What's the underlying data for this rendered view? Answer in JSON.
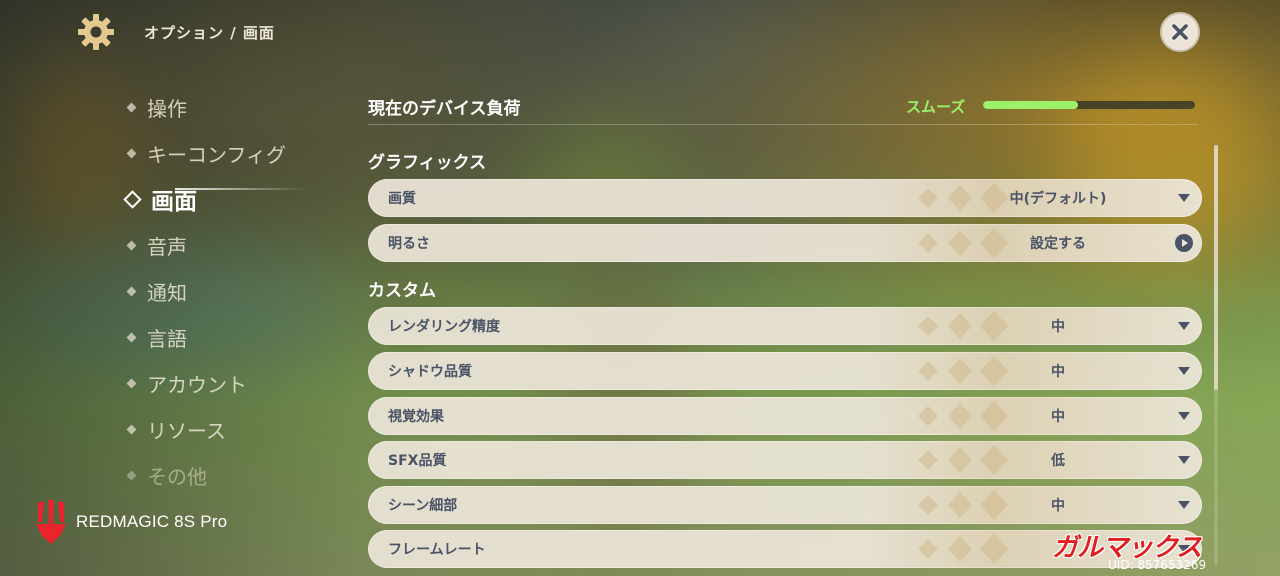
{
  "header": {
    "breadcrumb": "オプション / 画面",
    "gear_icon": "gear-icon",
    "close_icon": "close-icon"
  },
  "sidebar": {
    "items": [
      {
        "label": "操作",
        "state": "normal"
      },
      {
        "label": "キーコンフィグ",
        "state": "normal"
      },
      {
        "label": "画面",
        "state": "active"
      },
      {
        "label": "音声",
        "state": "normal"
      },
      {
        "label": "通知",
        "state": "normal"
      },
      {
        "label": "言語",
        "state": "normal"
      },
      {
        "label": "アカウント",
        "state": "normal"
      },
      {
        "label": "リソース",
        "state": "normal"
      },
      {
        "label": "その他",
        "state": "faded"
      }
    ]
  },
  "device_load": {
    "label": "現在のデバイス負荷",
    "status": "スムーズ",
    "level_fraction": 0.45,
    "color": "#9cf06a"
  },
  "graphics": {
    "title": "グラフィックス",
    "rows": [
      {
        "label": "画質",
        "value": "中(デフォルト)",
        "control": "dropdown"
      },
      {
        "label": "明るさ",
        "value": "設定する",
        "control": "action"
      }
    ]
  },
  "custom": {
    "title": "カスタム",
    "rows": [
      {
        "label": "レンダリング精度",
        "value": "中",
        "control": "dropdown"
      },
      {
        "label": "シャドウ品質",
        "value": "中",
        "control": "dropdown"
      },
      {
        "label": "視覚効果",
        "value": "中",
        "control": "dropdown"
      },
      {
        "label": "SFX品質",
        "value": "低",
        "control": "dropdown"
      },
      {
        "label": "シーン細部",
        "value": "中",
        "control": "dropdown"
      },
      {
        "label": "フレームレート",
        "value": "",
        "control": "dropdown"
      }
    ]
  },
  "overlay": {
    "brand": "REDMAGIC 8S Pro",
    "watermark": "ガルマックス",
    "uid": "UID: 857653269"
  },
  "colors": {
    "panel_text": "#4a5366",
    "panel_bg": "#ece5d8",
    "accent_green": "#9cf06a",
    "watermark_red": "#e02020"
  }
}
